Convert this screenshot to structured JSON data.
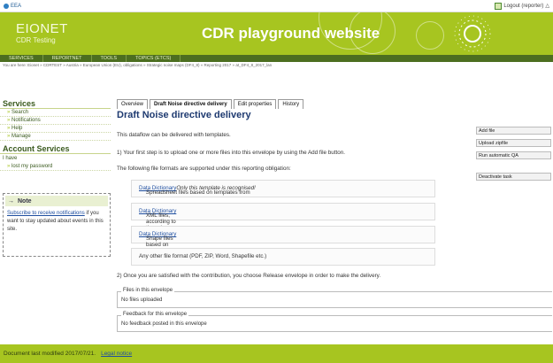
{
  "topbar": {
    "brand": "EEA",
    "logout": "Logout (reporter)"
  },
  "banner": {
    "brand": "EIONET",
    "subtitle": "CDR Testing",
    "title": "CDR playground website"
  },
  "nav": [
    "SERVICES",
    "REPORTNET",
    "TOOLS",
    "TOPICS (ETCS)"
  ],
  "breadcrumb": "You are here: Eionet » CDRTEST » Austria » European Union (EU), obligations » Strategic noise maps (DF4_8) » Reporting 2017 » at_DF4_8_2017_lan",
  "sidebar": {
    "services_title": "Services",
    "services_items": [
      "Search",
      "Notifications",
      "Help",
      "Manage"
    ],
    "account_title": "Account Services",
    "account_user": "I have",
    "account_items": [
      "lost my password"
    ],
    "note_title": "Note",
    "note_link": "Subscribe to receive notifications",
    "note_text": " if you want to stay updated about events in this site."
  },
  "tabs": [
    "Overview",
    "Draft Noise directive delivery",
    "Edit properties",
    "History"
  ],
  "main": {
    "heading": "Draft Noise directive delivery",
    "p1": "This dataflow can be delivered with templates.",
    "p2": "1) Your first step is to upload one or more files into this envelope by using the Add file button.",
    "p3": "The following file formats are supported under this reporting obligation:",
    "formats": [
      {
        "pre": "Spreadsheet files based on templates from ",
        "link": "Data Dictionary",
        "post": ". ",
        "italic": "Only this template is recognised!"
      },
      {
        "pre": "XML files, according to the schema definitions in ",
        "link": "Data Dictionary",
        "post": "",
        "italic": ""
      },
      {
        "pre": "Shape files based on GIS templates from ",
        "link": "Data Dictionary",
        "post": "",
        "italic": ""
      },
      {
        "pre": "Any other file format (PDF, ZIP, Word, Shapefile etc.)",
        "link": "",
        "post": "",
        "italic": ""
      }
    ],
    "p4": "2) Once you are satisfied with the contribution, you choose Release envelope in order to make the delivery.",
    "files_legend": "Files in this envelope",
    "files_content": "No files uploaded",
    "feedback_legend": "Feedback for this envelope",
    "feedback_content": "No feedback posted in this envelope"
  },
  "actions": [
    "Add file",
    "Upload zipfile",
    "Run automatic QA",
    "Deactivate task"
  ],
  "footer": {
    "text": "Document last modified 2017/07/21.",
    "link": "Legal notice"
  }
}
